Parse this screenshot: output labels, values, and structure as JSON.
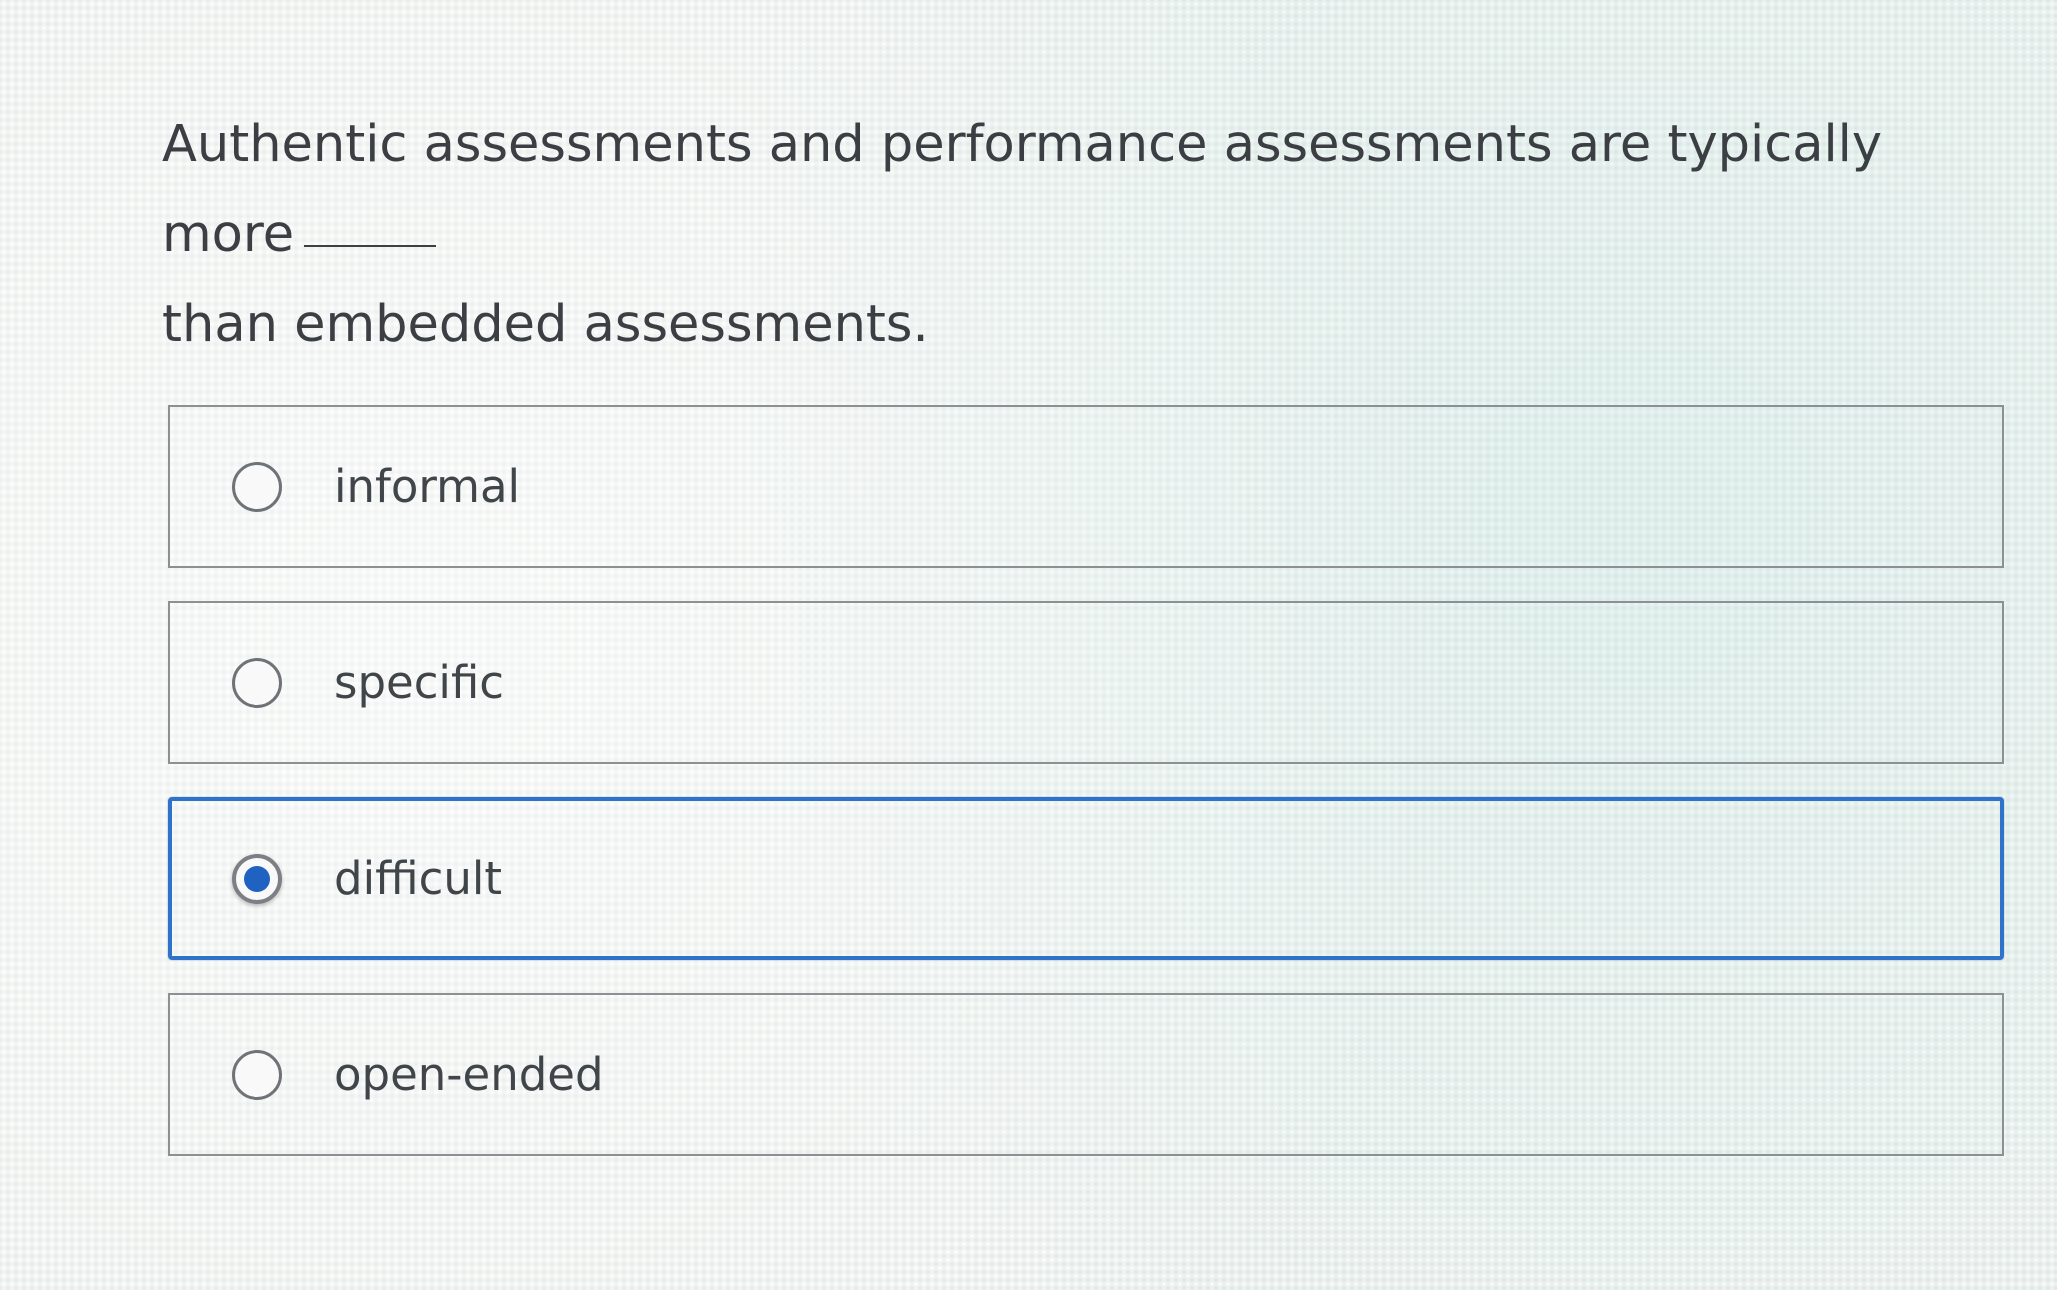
{
  "question": {
    "text_line1": "Authentic assessments and performance assessments are typically more",
    "text_line2": "than embedded assessments."
  },
  "options": [
    {
      "label": "informal",
      "selected": false
    },
    {
      "label": "specific",
      "selected": false
    },
    {
      "label": "difficult",
      "selected": true
    },
    {
      "label": "open-ended",
      "selected": false
    }
  ],
  "colors": {
    "accent": "#2e73c9",
    "radio_dot": "#1f62c1",
    "text": "#3b3f44",
    "border": "#8d9092"
  }
}
